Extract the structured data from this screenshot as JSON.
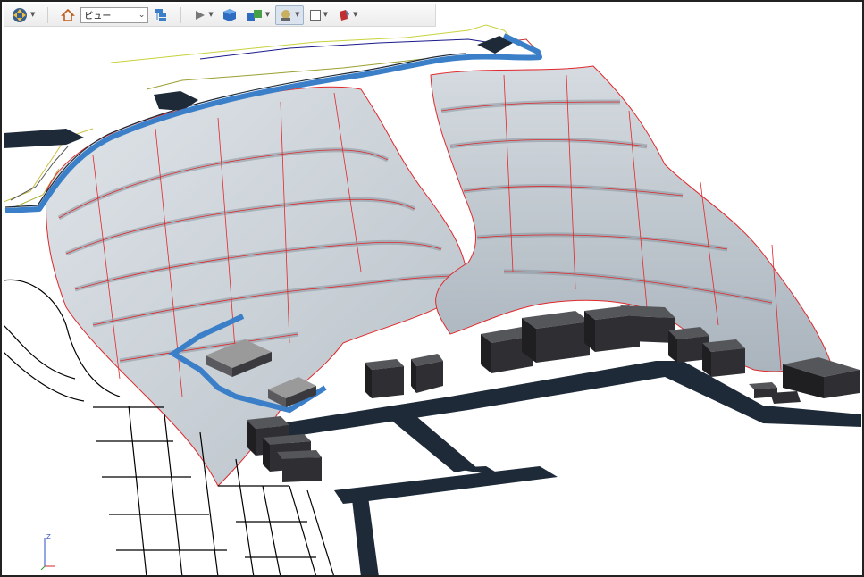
{
  "toolbar": {
    "navigate_icon": "move-arrows-icon",
    "home_icon": "home-icon",
    "view_dropdown_value": "ビュー",
    "scene_tree_icon": "tree-icon",
    "play_icon": "play-icon",
    "solid_cube_icon": "cube-icon",
    "multi_cube_icon": "cubes-icon",
    "render_mode_icon": "render-icon",
    "frame_icon": "square-outline-icon",
    "paint_icon": "paint-bucket-icon"
  },
  "viewport": {
    "description": "",
    "axis_label_z": "Z",
    "colors": {
      "terrain_fill": "#c3ccd3",
      "terrain_edge": "#e0282c",
      "road": "#1e2a38",
      "building": "#2f2f33",
      "highlight_blue": "#3a7fc8",
      "grid_line": "#000000"
    }
  }
}
